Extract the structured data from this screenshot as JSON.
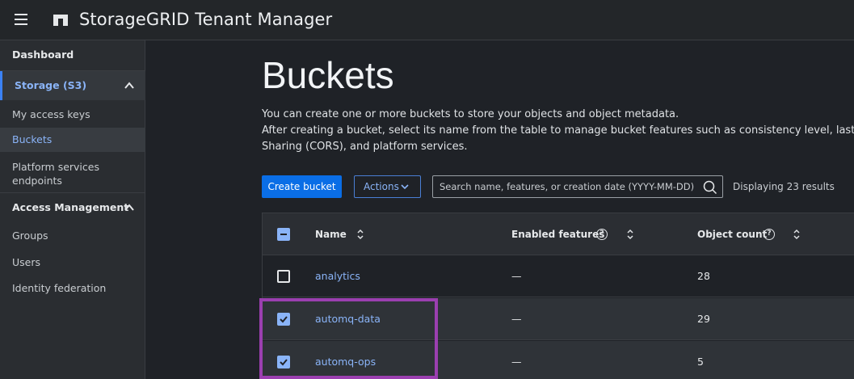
{
  "header": {
    "title": "StorageGRID Tenant Manager"
  },
  "sidebar": {
    "dashboard": "Dashboard",
    "storage": "Storage (S3)",
    "access_keys": "My access keys",
    "buckets": "Buckets",
    "platform_line1": "Platform services",
    "platform_line2": "endpoints",
    "access_management": "Access Management",
    "groups": "Groups",
    "users": "Users",
    "identity": "Identity federation"
  },
  "main": {
    "title": "Buckets",
    "desc_line1": "You can create one or more buckets to store your objects and object metadata.",
    "desc_line2": "After creating a bucket, select its name from the table to manage bucket features such as consistency level, last acce",
    "desc_line3": "Sharing (CORS), and platform services.",
    "create_button": "Create bucket",
    "actions_button": "Actions",
    "search_placeholder": "Search name, features, or creation date (YYYY-MM-DD)",
    "results_text": "Displaying 23 results"
  },
  "table": {
    "columns": {
      "name": "Name",
      "features": "Enabled features",
      "count": "Object count"
    },
    "rows": [
      {
        "name": "analytics",
        "features": "—",
        "count": "28",
        "checked": false
      },
      {
        "name": "automq-data",
        "features": "—",
        "count": "29",
        "checked": true
      },
      {
        "name": "automq-ops",
        "features": "—",
        "count": "5",
        "checked": true
      }
    ]
  },
  "colors": {
    "accent": "#0a6ee6",
    "link": "#8ab4f8",
    "highlight": "#9b3fb0"
  },
  "icons": [
    "hamburger-icon",
    "netapp-logo-icon",
    "chevron-up-icon",
    "chevron-down-icon",
    "search-icon",
    "sort-icon",
    "help-icon",
    "checkbox-icon"
  ]
}
